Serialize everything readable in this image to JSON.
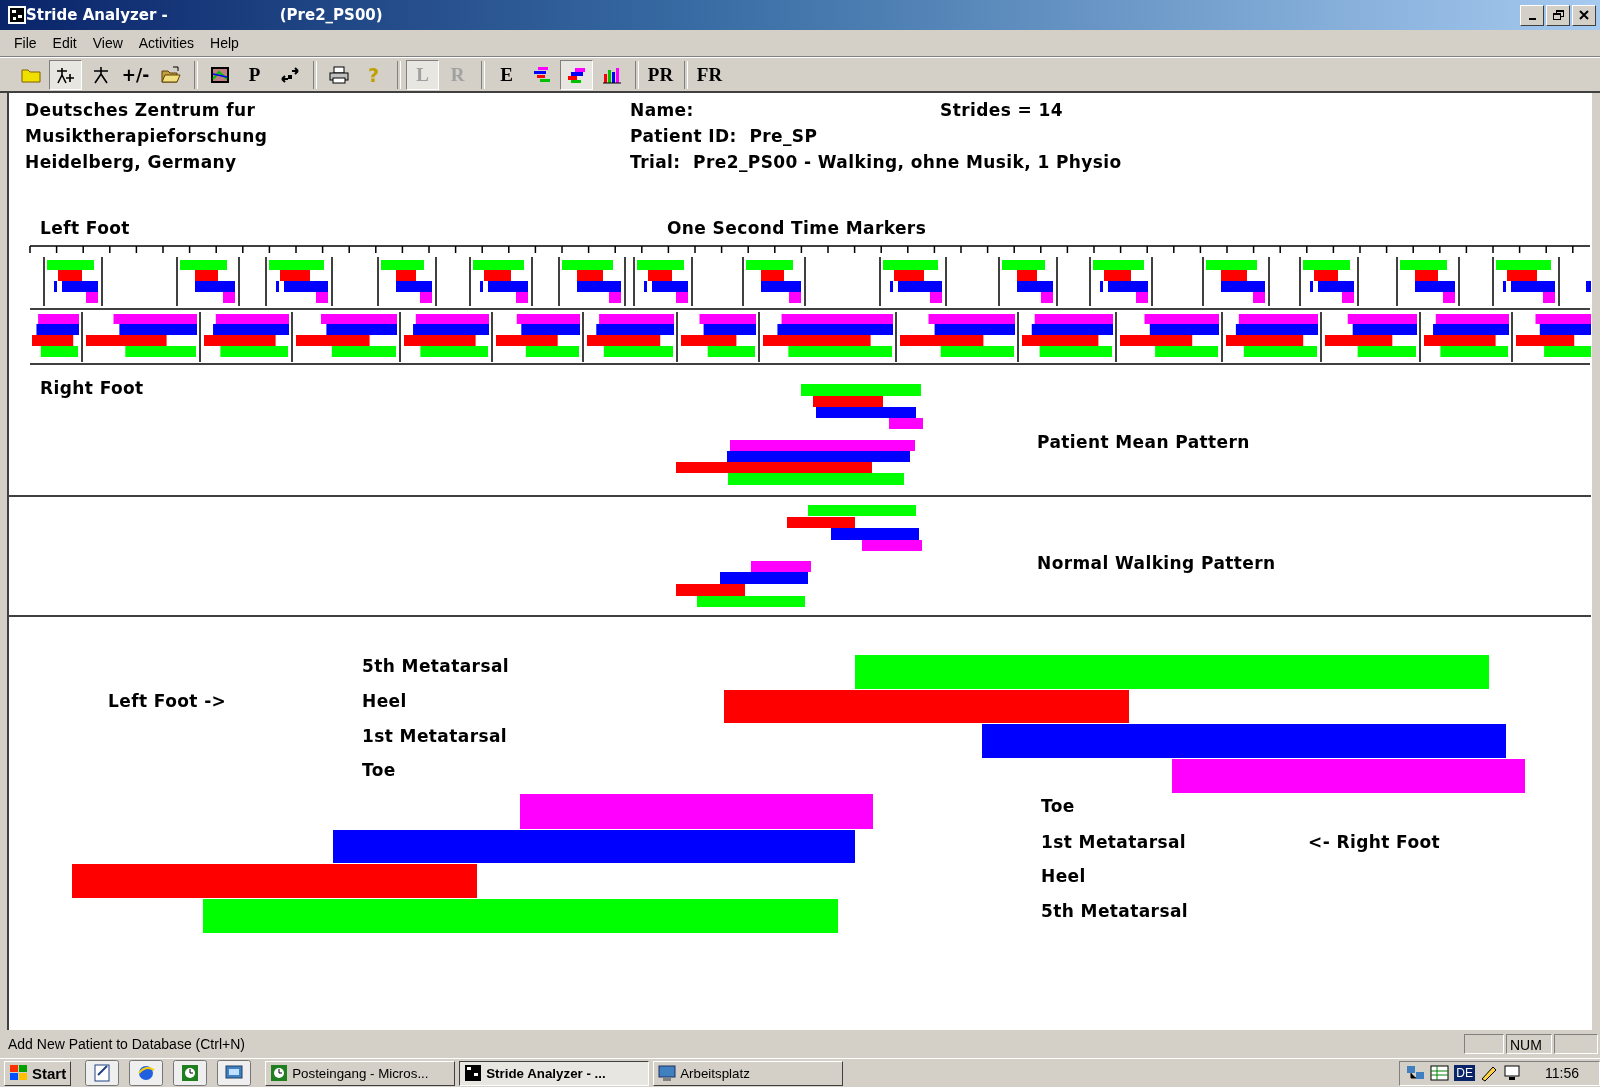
{
  "window": {
    "title": "Stride Analyzer -",
    "document": "(Pre2_PS00)"
  },
  "menu": [
    "File",
    "Edit",
    "View",
    "Activities",
    "Help"
  ],
  "toolbar": [
    {
      "kind": "icon",
      "pressed": false,
      "disabled": false
    },
    {
      "kind": "icon",
      "pressed": true,
      "disabled": false
    },
    {
      "kind": "icon",
      "pressed": false,
      "disabled": false
    },
    {
      "kind": "text",
      "label": "+/-",
      "pressed": false,
      "disabled": false
    },
    {
      "kind": "icon",
      "pressed": false,
      "disabled": false
    },
    {
      "kind": "separator"
    },
    {
      "kind": "icon",
      "pressed": false,
      "disabled": false
    },
    {
      "kind": "text",
      "label": "P",
      "pressed": false,
      "disabled": false
    },
    {
      "kind": "icon",
      "pressed": false,
      "disabled": false
    },
    {
      "kind": "separator"
    },
    {
      "kind": "icon",
      "pressed": false,
      "disabled": false
    },
    {
      "kind": "text",
      "label": "?",
      "pressed": false,
      "disabled": false
    },
    {
      "kind": "separator"
    },
    {
      "kind": "text",
      "label": "L",
      "pressed": true,
      "disabled": true
    },
    {
      "kind": "text",
      "label": "R",
      "pressed": false,
      "disabled": true
    },
    {
      "kind": "separator"
    },
    {
      "kind": "text",
      "label": "E",
      "pressed": false,
      "disabled": false
    },
    {
      "kind": "icon",
      "pressed": false,
      "disabled": false
    },
    {
      "kind": "icon",
      "pressed": true,
      "disabled": false
    },
    {
      "kind": "icon",
      "pressed": false,
      "disabled": false
    },
    {
      "kind": "separator"
    },
    {
      "kind": "text",
      "label": "PR",
      "pressed": false,
      "disabled": false
    },
    {
      "kind": "separator"
    },
    {
      "kind": "text",
      "label": "FR",
      "pressed": false,
      "disabled": false
    }
  ],
  "header": {
    "institute": [
      "Deutsches Zentrum fur",
      "Musiktherapieforschung",
      "Heidelberg, Germany"
    ],
    "name_label": "Name:",
    "patient_id": "Patient ID:  Pre_SP",
    "trial": "Trial:  Pre2_PS00 - Walking, ohne Musik, 1 Physio",
    "strides": "Strides = 14"
  },
  "timeline": {
    "left_label": "Left Foot",
    "title": "One Second Time Markers",
    "right_label": "Right Foot"
  },
  "mean_pattern": {
    "label": "Patient Mean Pattern"
  },
  "normal_pattern": {
    "label": "Normal Walking Pattern"
  },
  "legend": {
    "left_foot_label": "Left Foot ->",
    "left_sensors": [
      "5th Metatarsal",
      "Heel",
      "1st Metatarsal",
      "Toe"
    ],
    "right_sensors": [
      "Toe",
      "1st Metatarsal",
      "Heel",
      "5th Metatarsal"
    ],
    "right_foot_label": "<- Right Foot"
  },
  "status_bar": {
    "text": "Add New Patient to Database (Ctrl+N)",
    "num": "NUM"
  },
  "taskbar": {
    "start": "Start",
    "tasks": [
      {
        "label": "Posteingang - Micros...",
        "selected": false
      },
      {
        "label": "Stride Analyzer - ...",
        "selected": true
      },
      {
        "label": "Arbeitsplatz",
        "selected": false
      }
    ],
    "language": "DE",
    "clock": "11:56"
  }
}
